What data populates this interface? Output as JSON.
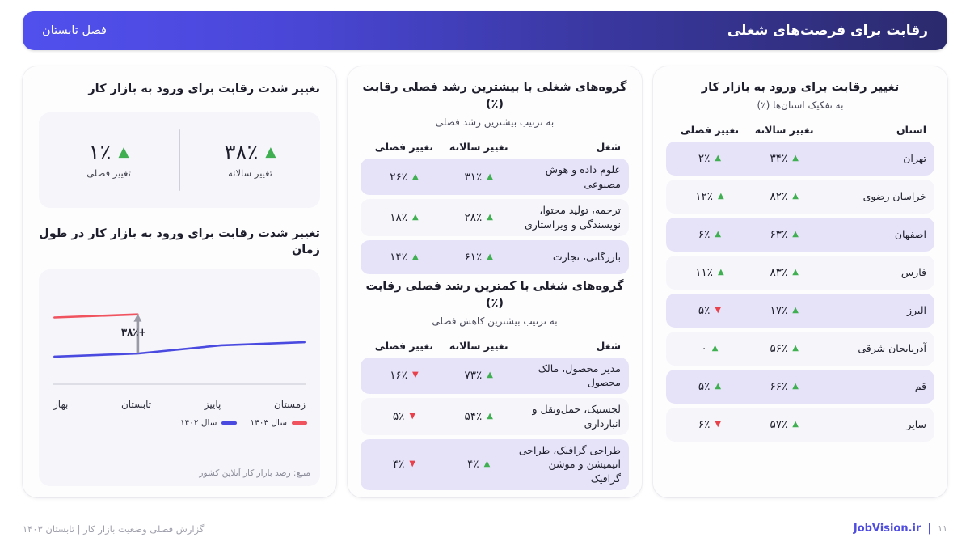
{
  "header": {
    "title": "رقابت برای فرصت‌های شغلی",
    "season": "فصل تابستان",
    "gradient_start": "#2b2a6d",
    "gradient_end": "#5150ee"
  },
  "left_card": {
    "title": "تغییر رقابت برای ورود به بازار کار",
    "subtitle": "به تفکیک استان‌ها (٪)",
    "columns": {
      "name": "استان",
      "yearly": "تغییر سالانه",
      "quarterly": "تغییر فصلی"
    },
    "rows": [
      {
        "name": "تهران",
        "yearly": "۳۴٪",
        "yearly_dir": "up",
        "quarterly": "۲٪",
        "quarterly_dir": "up"
      },
      {
        "name": "خراسان رضوی",
        "yearly": "۸۲٪",
        "yearly_dir": "up",
        "quarterly": "۱۲٪",
        "quarterly_dir": "up"
      },
      {
        "name": "اصفهان",
        "yearly": "۶۳٪",
        "yearly_dir": "up",
        "quarterly": "۶٪",
        "quarterly_dir": "up"
      },
      {
        "name": "فارس",
        "yearly": "۸۳٪",
        "yearly_dir": "up",
        "quarterly": "۱۱٪",
        "quarterly_dir": "up"
      },
      {
        "name": "البرز",
        "yearly": "۱۷٪",
        "yearly_dir": "up",
        "quarterly": "۵٪",
        "quarterly_dir": "down"
      },
      {
        "name": "آذربایجان شرقی",
        "yearly": "۵۶٪",
        "yearly_dir": "up",
        "quarterly": "۰",
        "quarterly_dir": "up"
      },
      {
        "name": "قم",
        "yearly": "۶۶٪",
        "yearly_dir": "up",
        "quarterly": "۵٪",
        "quarterly_dir": "up"
      },
      {
        "name": "سایر",
        "yearly": "۵۷٪",
        "yearly_dir": "up",
        "quarterly": "۶٪",
        "quarterly_dir": "down"
      }
    ]
  },
  "mid_card": {
    "top": {
      "title": "گروه‌های شغلی با بیشترین رشد فصلی رقابت (٪)",
      "subtitle": "به ترتیب بیشترین رشد فصلی",
      "columns": {
        "name": "شغل",
        "yearly": "تغییر سالانه",
        "quarterly": "تغییر فصلی"
      },
      "rows": [
        {
          "name": "علوم داده و هوش مصنوعی",
          "yearly": "۳۱٪",
          "yearly_dir": "up",
          "quarterly": "۲۶٪",
          "quarterly_dir": "up"
        },
        {
          "name": "ترجمه، تولید محتوا، نویسندگی و ویراستاری",
          "yearly": "۲۸٪",
          "yearly_dir": "up",
          "quarterly": "۱۸٪",
          "quarterly_dir": "up"
        },
        {
          "name": "بازرگانی، تجارت",
          "yearly": "۶۱٪",
          "yearly_dir": "up",
          "quarterly": "۱۴٪",
          "quarterly_dir": "up"
        }
      ]
    },
    "bottom": {
      "title": "گروه‌های شغلی با کمترین رشد فصلی رقابت (٪)",
      "subtitle": "به ترتیب بیشترین کاهش فصلی",
      "columns": {
        "name": "شغل",
        "yearly": "تغییر سالانه",
        "quarterly": "تغییر فصلی"
      },
      "rows": [
        {
          "name": "مدیر محصول، مالک محصول",
          "yearly": "۷۳٪",
          "yearly_dir": "up",
          "quarterly": "۱۶٪",
          "quarterly_dir": "down"
        },
        {
          "name": "لجستیک، حمل‌ونقل و انبارداری",
          "yearly": "۵۴٪",
          "yearly_dir": "up",
          "quarterly": "۵٪",
          "quarterly_dir": "down"
        },
        {
          "name": "طراحی گرافیک، طراحی انیمیشن و موشن گرافیک",
          "yearly": "۴٪",
          "yearly_dir": "up",
          "quarterly": "۴٪",
          "quarterly_dir": "down"
        }
      ]
    }
  },
  "right_card": {
    "title": "تغییر شدت رقابت برای ورود به بازار کار",
    "kpis": [
      {
        "value": "۳۸٪",
        "dir": "up",
        "label": "تغییر سالانه"
      },
      {
        "value": "۱٪",
        "dir": "up",
        "label": "تغییر فصلی"
      }
    ],
    "chart_title": "تغییر شدت رقابت برای ورود به بازار کار در طول زمان",
    "source": "منبع: رصد بازار کار آنلاین کشور"
  },
  "chart_data": {
    "type": "line",
    "title": "تغییر شدت رقابت برای ورود به بازار کار در طول زمان",
    "xlabel": "",
    "ylabel": "",
    "grid": false,
    "legend_position": "bottom-right",
    "categories": [
      "زمستان",
      "پاییز",
      "تابستان",
      "بهار"
    ],
    "categories_ltr_order": [
      "بهار",
      "تابستان",
      "پاییز",
      "زمستان"
    ],
    "annotation": "+۳۸٪",
    "series": [
      {
        "name": "سال ۱۴۰۳",
        "color": "#f0525e",
        "x": [
          "بهار",
          "تابستان"
        ],
        "values": [
          100,
          103
        ]
      },
      {
        "name": "سال ۱۴۰۲",
        "color": "#4b4ae0",
        "x": [
          "بهار",
          "تابستان",
          "پاییز",
          "زمستان"
        ],
        "values": [
          62,
          65,
          73,
          76
        ]
      }
    ],
    "ylim": [
      40,
      120
    ]
  },
  "footer": {
    "page": "۱۱",
    "separator": "|",
    "brand": "JobVision.ir",
    "report": "گزارش فصلی وضعیت بازار کار | تابستان ۱۴۰۳"
  }
}
